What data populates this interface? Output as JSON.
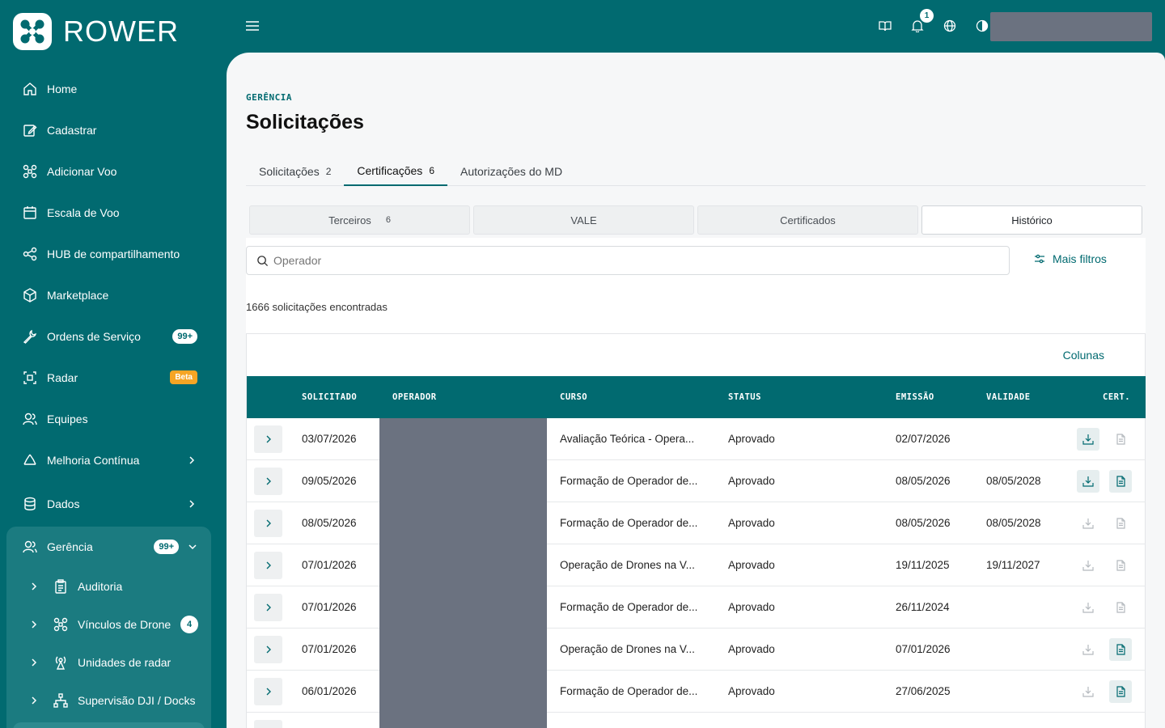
{
  "app": {
    "logo_text": "ROWER"
  },
  "sidebar": {
    "items": [
      {
        "label": "Home",
        "icon": "home-icon"
      },
      {
        "label": "Cadastrar",
        "icon": "edit-icon"
      },
      {
        "label": "Adicionar Voo",
        "icon": "drone-icon"
      },
      {
        "label": "Escala de Voo",
        "icon": "calendar-icon"
      },
      {
        "label": "HUB de compartilhamento",
        "icon": "share-icon"
      },
      {
        "label": "Marketplace",
        "icon": "box-icon"
      },
      {
        "label": "Ordens de Serviço",
        "icon": "wrench-icon",
        "badge": "99+"
      },
      {
        "label": "Radar",
        "icon": "radar-icon",
        "beta": "Beta"
      },
      {
        "label": "Equipes",
        "icon": "users-icon"
      },
      {
        "label": "Melhoria Contínua",
        "icon": "recycle-icon"
      },
      {
        "label": "Dados",
        "icon": "database-icon"
      }
    ],
    "group": {
      "label": "Gerência",
      "badge": "99+",
      "sub_items": [
        {
          "label": "Auditoria",
          "icon": "clipboard-icon"
        },
        {
          "label": "Vínculos de Drone",
          "icon": "drone-icon",
          "badge": "4"
        },
        {
          "label": "Unidades de radar",
          "icon": "antenna-icon"
        },
        {
          "label": "Supervisão DJI / Docks",
          "icon": "network-icon"
        }
      ]
    }
  },
  "topbar": {
    "notification_count": "1"
  },
  "page": {
    "breadcrumb": "GERÊNCIA",
    "title": "Solicitações",
    "tabs": [
      {
        "label": "Solicitações",
        "count": "2"
      },
      {
        "label": "Certificações",
        "count": "6"
      },
      {
        "label": "Autorizações do MD",
        "count": ""
      }
    ],
    "segments": [
      {
        "label": "Terceiros",
        "count": "6"
      },
      {
        "label": "VALE",
        "count": ""
      },
      {
        "label": "Certificados",
        "count": ""
      },
      {
        "label": "Histórico",
        "count": ""
      }
    ],
    "search_placeholder": "Operador",
    "more_filters": "Mais filtros",
    "results_text": "1666 solicitações encontradas",
    "columns_button": "Colunas"
  },
  "table": {
    "headers": [
      "SOLICITADO",
      "OPERADOR",
      "CURSO",
      "STATUS",
      "EMISSÃO",
      "VALIDADE",
      "CERT."
    ],
    "rows": [
      {
        "solicitado": "03/07/2026",
        "curso": "Avaliação Teórica - Opera...",
        "status": "Aprovado",
        "emissao": "02/07/2026",
        "validade": "",
        "download": true,
        "doc": false
      },
      {
        "solicitado": "09/05/2026",
        "curso": "Formação de Operador de...",
        "status": "Aprovado",
        "emissao": "08/05/2026",
        "validade": "08/05/2028",
        "download": true,
        "doc": true
      },
      {
        "solicitado": "08/05/2026",
        "curso": "Formação de Operador de...",
        "status": "Aprovado",
        "emissao": "08/05/2026",
        "validade": "08/05/2028",
        "download": false,
        "doc": false
      },
      {
        "solicitado": "07/01/2026",
        "curso": "Operação de Drones na V...",
        "status": "Aprovado",
        "emissao": "19/11/2025",
        "validade": "19/11/2027",
        "download": false,
        "doc": false
      },
      {
        "solicitado": "07/01/2026",
        "curso": "Formação de Operador de...",
        "status": "Aprovado",
        "emissao": "26/11/2024",
        "validade": "",
        "download": false,
        "doc": false
      },
      {
        "solicitado": "07/01/2026",
        "curso": "Operação de Drones na V...",
        "status": "Aprovado",
        "emissao": "07/01/2026",
        "validade": "",
        "download": false,
        "doc": true
      },
      {
        "solicitado": "06/01/2026",
        "curso": "Formação de Operador de...",
        "status": "Aprovado",
        "emissao": "27/06/2025",
        "validade": "",
        "download": false,
        "doc": true
      },
      {
        "solicitado": "",
        "curso": "",
        "status": "",
        "emissao": "",
        "validade": "",
        "download": false,
        "doc": false
      }
    ]
  },
  "colors": {
    "primary": "#016a70",
    "redacted": "#6b7280",
    "beta": "#f5a524"
  }
}
